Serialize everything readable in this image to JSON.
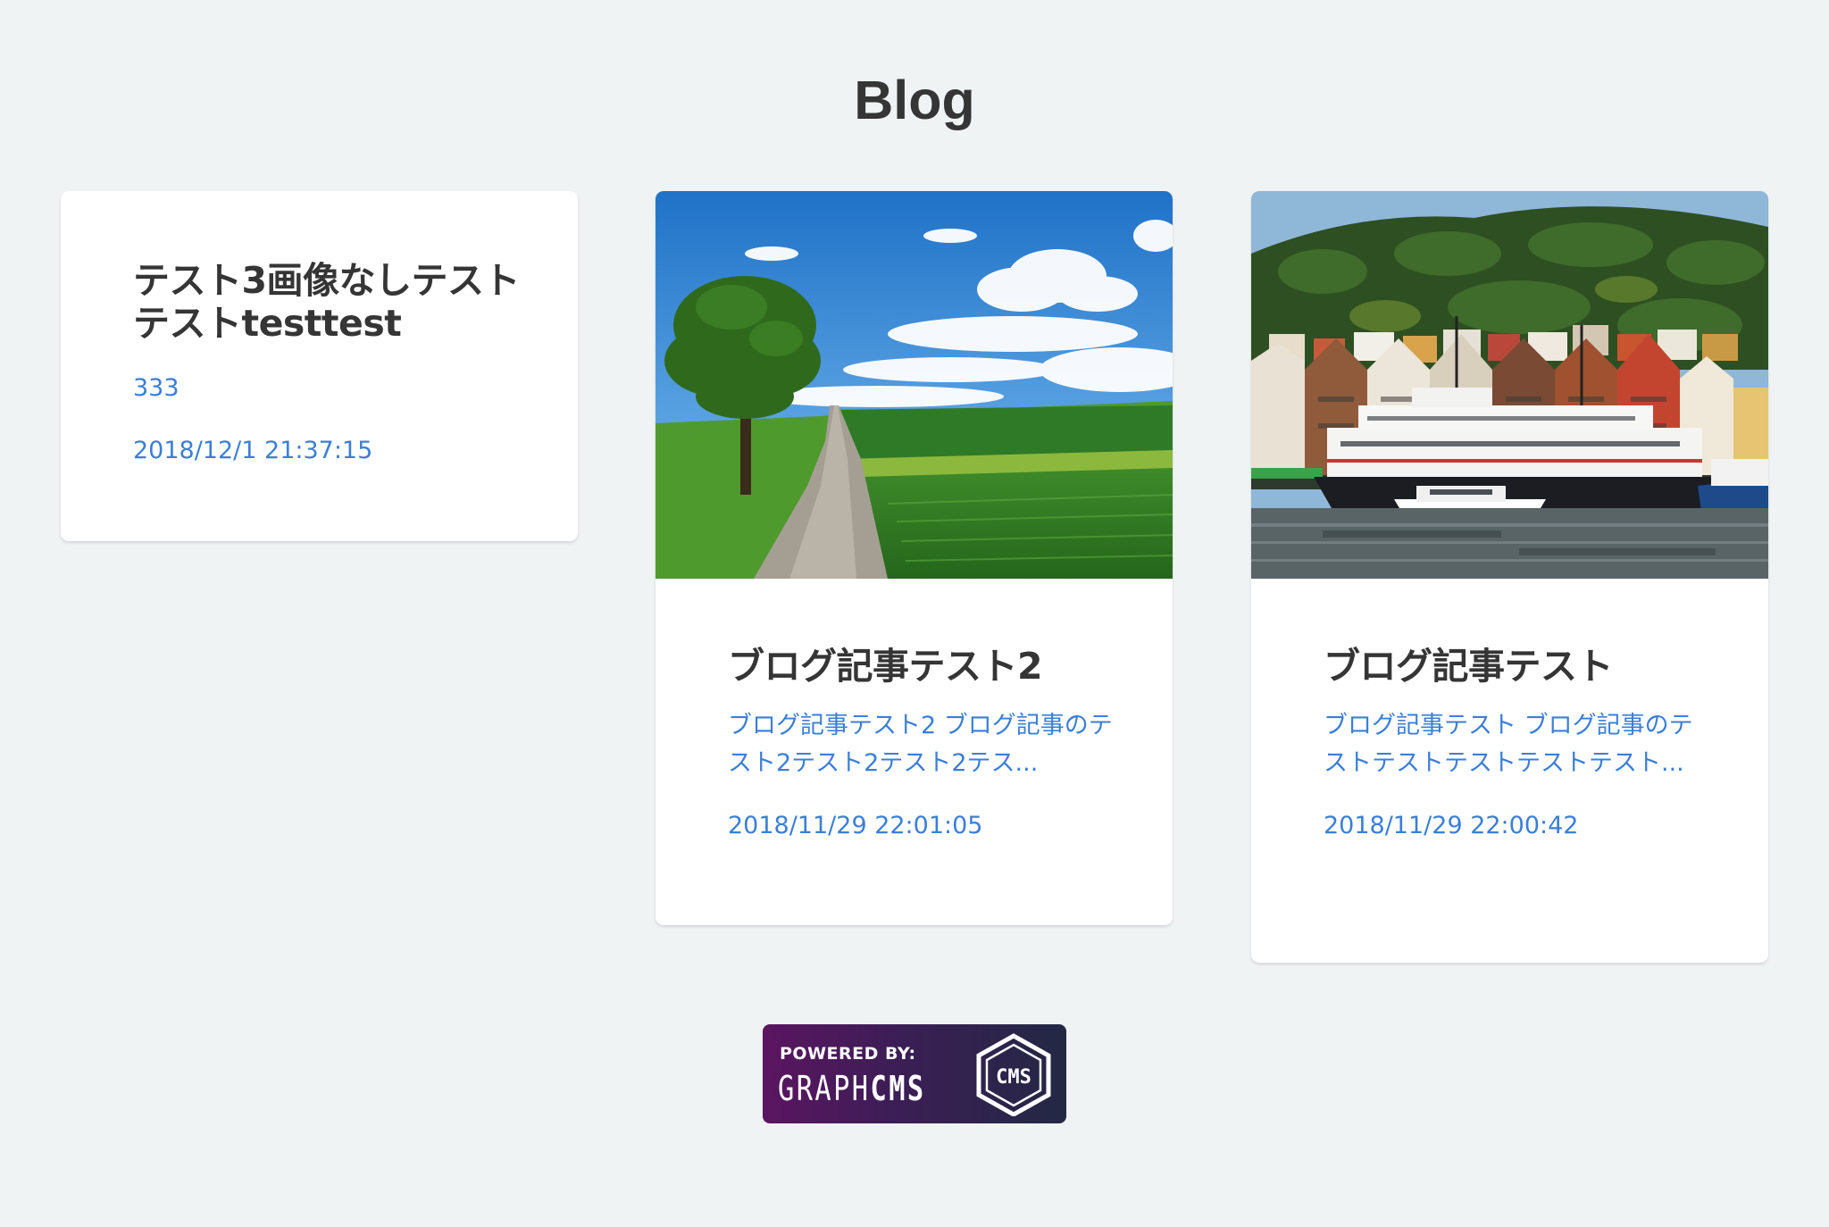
{
  "page": {
    "title": "Blog"
  },
  "posts": [
    {
      "title": "テスト3画像なしテストテストtesttest",
      "description": "333",
      "date": "2018/12/1 21:37:15",
      "image": null
    },
    {
      "title": "ブログ記事テスト2",
      "description": "ブログ記事テスト2 ブログ記事のテスト2テスト2テスト2テス...",
      "date": "2018/11/29 22:01:05",
      "image": "landscape-road-tree-field"
    },
    {
      "title": "ブログ記事テスト",
      "description": "ブログ記事テスト ブログ記事のテストテストテストテストテスト...",
      "date": "2018/11/29 22:00:42",
      "image": "harbor-town-ships"
    }
  ],
  "footer": {
    "powered_by_label": "POWERED BY:",
    "brand_light": "GRAPH",
    "brand_bold": "CMS",
    "logo_text": "CMS"
  },
  "colors": {
    "background": "#f0f3f4",
    "title": "#353535",
    "link": "#3b7fd6",
    "card": "#ffffff"
  }
}
